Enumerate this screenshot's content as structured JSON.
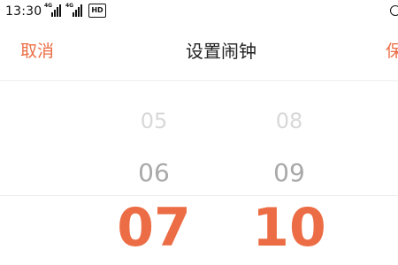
{
  "status_bar": {
    "time": "13:30",
    "signal1_tag": "4G",
    "signal2_tag": "4G",
    "hd_label": "HD"
  },
  "header": {
    "cancel_label": "取消",
    "title": "设置闹钟",
    "save_label": "保"
  },
  "picker": {
    "hours": {
      "prev2": "05",
      "prev1": "06",
      "selected": "07"
    },
    "minutes": {
      "prev2": "08",
      "prev1": "09",
      "selected": "10"
    }
  },
  "colors": {
    "accent": "#ec6d45",
    "title": "#222222",
    "faded": "#d8d8d8",
    "dim": "#a9a9a9"
  }
}
